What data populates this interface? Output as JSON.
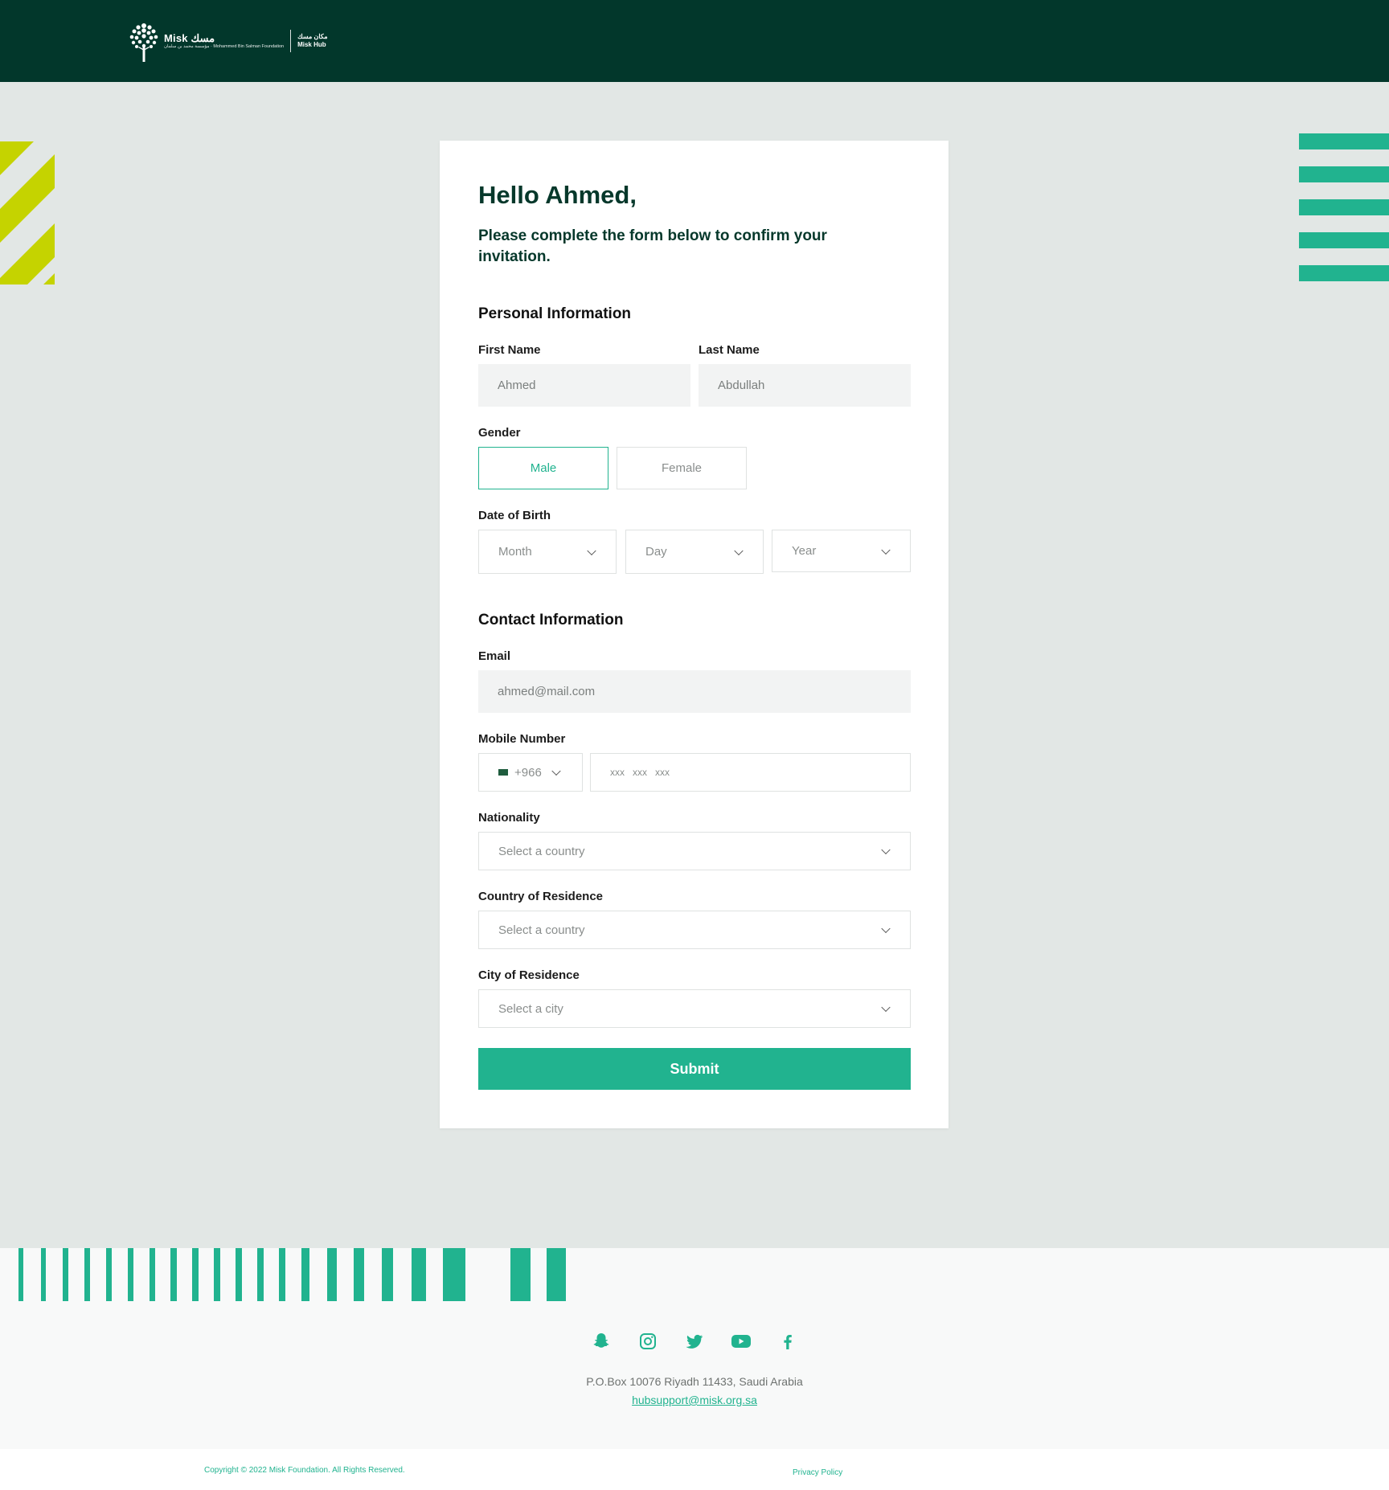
{
  "header": {
    "logo_main": "Misk مسك",
    "logo_sub": "مؤسسة محمد بن سلمان · Mohammed Bin Salman Foundation",
    "hub_ar": "مكان مسك",
    "hub_en": "Misk Hub"
  },
  "form": {
    "greeting": "Hello Ahmed,",
    "intro": "Please complete the form below to confirm your invitation.",
    "personal_section": "Personal Information",
    "first_name_label": "First Name",
    "first_name_value": "Ahmed",
    "last_name_label": "Last Name",
    "last_name_value": "Abdullah",
    "gender_label": "Gender",
    "gender_male": "Male",
    "gender_female": "Female",
    "gender_selected": "Male",
    "dob_label": "Date of Birth",
    "dob_month": "Month",
    "dob_day": "Day",
    "dob_year": "Year",
    "contact_section": "Contact Information",
    "email_label": "Email",
    "email_value": "ahmed@mail.com",
    "mobile_label": "Mobile Number",
    "country_code": "+966",
    "mobile_placeholder": "xxx   xxx   xxx",
    "nationality_label": "Nationality",
    "nationality_placeholder": "Select a country",
    "residence_country_label": "Country of Residence",
    "residence_country_placeholder": "Select a country",
    "residence_city_label": "City of Residence",
    "residence_city_placeholder": "Select a city",
    "submit_label": "Submit"
  },
  "footer": {
    "social_icons": [
      "snapchat-icon",
      "instagram-icon",
      "twitter-icon",
      "youtube-icon",
      "facebook-icon"
    ],
    "address": "P.O.Box 10076 Riyadh 11433, Saudi Arabia",
    "support_email": "hubsupport@misk.org.sa",
    "copyright": "Copyright © 2022 Misk Foundation. All Rights Reserved.",
    "privacy": "Privacy Policy"
  },
  "colors": {
    "header_bg": "#02372b",
    "accent": "#21b38f",
    "lime": "#c5d300",
    "page_bg": "#e2e7e5"
  }
}
